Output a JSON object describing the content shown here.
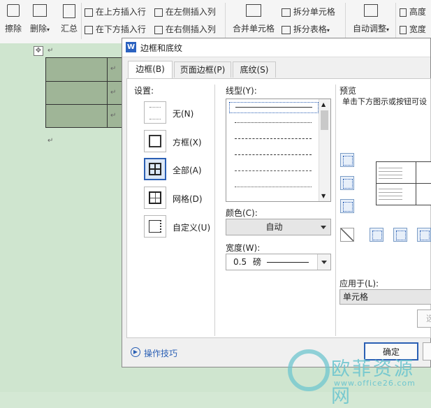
{
  "ribbon": {
    "erase_label": "擦除",
    "delete_label": "删除",
    "summary_label": "汇总",
    "insert_above": "在上方插入行",
    "insert_below": "在下方插入行",
    "insert_left": "在左侧插入列",
    "insert_right": "在右侧插入列",
    "merge_cells": "合并单元格",
    "split_cells": "拆分单元格",
    "split_table": "拆分表格",
    "auto_adjust": "自动调整",
    "height": "高度",
    "width": "宽度"
  },
  "dialog": {
    "title": "边框和底纹",
    "tabs": [
      "边框(B)",
      "页面边框(P)",
      "底纹(S)"
    ],
    "settings_label": "设置:",
    "settings": [
      {
        "label": "无(N)",
        "icon": "border-none-icon"
      },
      {
        "label": "方框(X)",
        "icon": "border-box-icon"
      },
      {
        "label": "全部(A)",
        "icon": "border-all-icon"
      },
      {
        "label": "网格(D)",
        "icon": "border-grid-icon"
      },
      {
        "label": "自定义(U)",
        "icon": "border-custom-icon"
      }
    ],
    "line_style_label": "线型(Y):",
    "color_label": "颜色(C):",
    "color_value": "自动",
    "width_label": "宽度(W):",
    "width_value": "0.5",
    "width_unit": "磅",
    "preview_label": "预览",
    "preview_hint": "单击下方图示或按钮可设",
    "apply_label": "应用于(L):",
    "apply_value": "单元格",
    "options_btn": "选",
    "tips_label": "操作技巧",
    "ok_label": "确定"
  },
  "watermark": {
    "text": "欧菲资源网",
    "url": "www.office26.com"
  }
}
